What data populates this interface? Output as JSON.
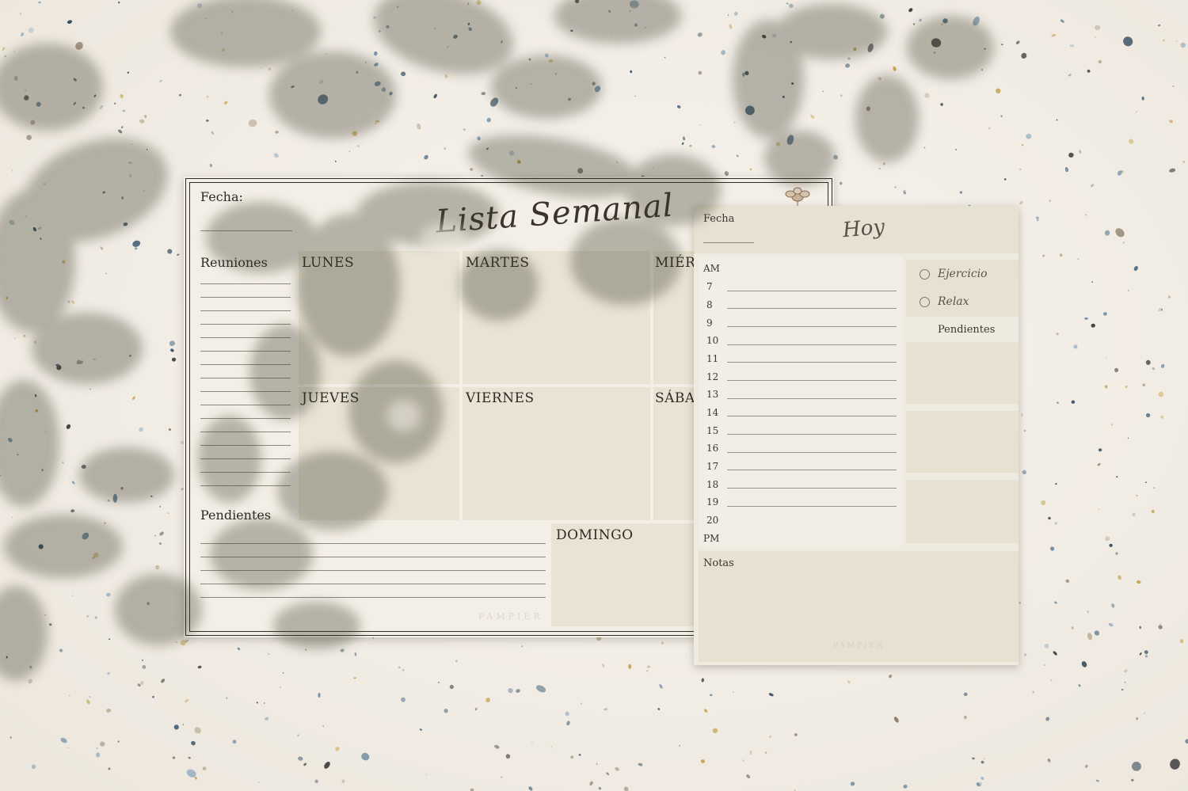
{
  "weekly": {
    "fecha_label": "Fecha:",
    "title": "Lista Semanal",
    "reuniones_label": "Reuniones",
    "pendientes_label": "Pendientes",
    "days": [
      "LUNES",
      "MARTES",
      "MIÉRC",
      "JUEVES",
      "VIERNES",
      "SÁBA",
      "DOMINGO"
    ],
    "brand": "PAMPIER"
  },
  "daily": {
    "fecha_label": "Fecha",
    "title": "Hoy",
    "am_label": "AM",
    "pm_label": "PM",
    "hours": [
      "7",
      "8",
      "9",
      "10",
      "11",
      "12",
      "13",
      "14",
      "15",
      "16",
      "17",
      "18",
      "19",
      "20"
    ],
    "checklist": [
      "Ejercicio",
      "Relax"
    ],
    "pendientes_label": "Pendientes",
    "notas_label": "Notas",
    "brand": "PAMPIER"
  },
  "colors": {
    "background": "#f2ede6",
    "paper": "#f4efe6",
    "cell": "#e8e3d3",
    "ink": "#2e2a25",
    "leaf_shadow": "#3c3a2c"
  }
}
